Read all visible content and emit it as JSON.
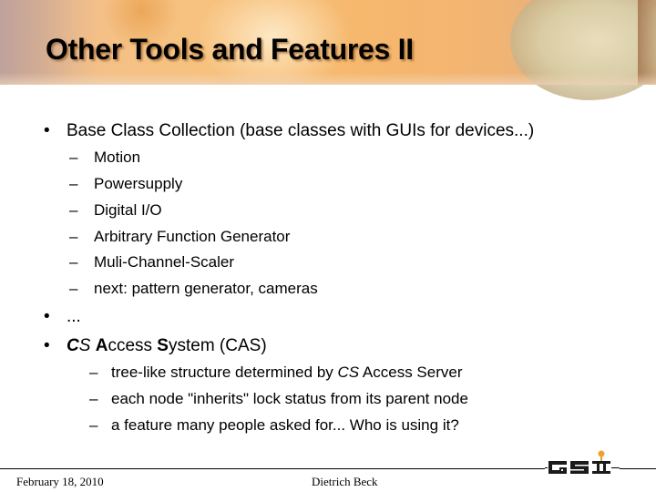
{
  "slide": {
    "title": "Other Tools and Features II",
    "bullets": [
      {
        "bullet_glyph": "•",
        "text": "Base Class Collection (base classes with GUIs for devices...)",
        "subitems": [
          {
            "dash": "–",
            "text": "Motion"
          },
          {
            "dash": "–",
            "text": "Powersupply"
          },
          {
            "dash": "–",
            "text": "Digital I/O"
          },
          {
            "dash": "–",
            "text": "Arbitrary Function Generator"
          },
          {
            "dash": "–",
            "text": "Muli-Channel-Scaler"
          },
          {
            "dash": "–",
            "text": "next: pattern generator, cameras"
          }
        ]
      },
      {
        "bullet_glyph": "•",
        "text": "...",
        "subitems": []
      },
      {
        "bullet_glyph": "•",
        "text_parts": [
          {
            "text": "C",
            "style": "bold-italic"
          },
          {
            "text": "S",
            "style": "italic"
          },
          {
            "text": " ",
            "style": "normal"
          },
          {
            "text": "A",
            "style": "bold"
          },
          {
            "text": "ccess ",
            "style": "normal"
          },
          {
            "text": "S",
            "style": "bold"
          },
          {
            "text": "ystem (CAS)",
            "style": "normal"
          }
        ],
        "subitems": [
          {
            "dash": "–",
            "text_parts": [
              {
                "text": "tree-like structure determined by ",
                "style": "normal"
              },
              {
                "text": "CS",
                "style": "italic"
              },
              {
                "text": " Access Server",
                "style": "normal"
              }
            ]
          },
          {
            "dash": "–",
            "text": "each node \"inherits\" lock status from its parent node"
          },
          {
            "dash": "–",
            "text": "a feature many people asked for... Who is using it?"
          }
        ]
      }
    ]
  },
  "footer": {
    "date": "February 18, 2010",
    "author": "Dietrich Beck",
    "logo_text": "GSI",
    "logo_dot_color": "#f0a030"
  },
  "colors": {
    "banner_accent": "#f6b86d",
    "text": "#000000"
  }
}
